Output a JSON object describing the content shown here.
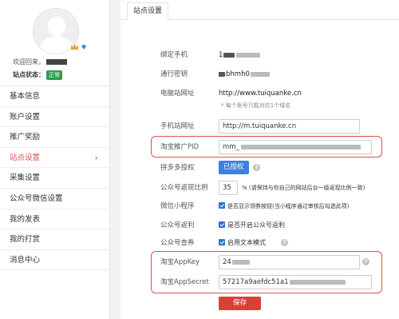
{
  "profile": {
    "welcome_label": "欢迎回来，",
    "status_label": "站点状态：",
    "status_badge": "正常"
  },
  "sidebar": {
    "items": [
      {
        "label": "基本信息"
      },
      {
        "label": "账户设置"
      },
      {
        "label": "推广奖励"
      },
      {
        "label": "站点设置",
        "active": true
      },
      {
        "label": "采集设置"
      },
      {
        "label": "公众号微信设置"
      },
      {
        "label": "我的发表"
      },
      {
        "label": "我的打赏"
      },
      {
        "label": "消息中心"
      }
    ]
  },
  "tabs": {
    "site_settings": "站点设置"
  },
  "form": {
    "bind_phone": {
      "label": "绑定手机",
      "value": "1"
    },
    "comm_password": {
      "label": "通行密钥",
      "value": "bhmh0"
    },
    "pc_site": {
      "label": "电脑站网址",
      "value": "http://www.tuiquanke.cn",
      "hint": "* 每个账号只能对应1个域名"
    },
    "mobile_site": {
      "label": "手机站网址",
      "value": "http://m.tuiquanke.cn"
    },
    "taobao_pid": {
      "label": "淘宝推广PID",
      "value": "mm_"
    },
    "pdd_auth": {
      "label": "拼多多授权",
      "button": "已授权"
    },
    "rebate_ratio": {
      "label": "公众号返现比例",
      "value": "35",
      "suffix": "% (请保持与你自己的网站后台一级返现比例一致)"
    },
    "mini_program": {
      "label": "微信小程序",
      "checkbox": "是否显示领券按钮(当小程序通过审核后勾选此项)"
    },
    "mp_rebate": {
      "label": "公众号返利",
      "checkbox": "是否开启公众号返利"
    },
    "mp_coupon": {
      "label": "公众号查券",
      "checkbox": "启用文本模式"
    },
    "app_key": {
      "label": "淘宝AppKey",
      "value": "24"
    },
    "app_secret": {
      "label": "淘宝AppSecret",
      "value": "57217a9aefdc51a1"
    },
    "save_label": "保存"
  },
  "colors": {
    "accent": "#d9534f",
    "primary_button": "#3f7fdf",
    "status": "#2e9e4f"
  }
}
